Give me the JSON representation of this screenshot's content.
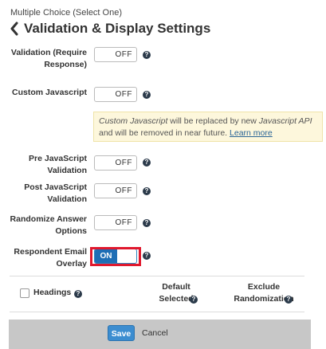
{
  "breadcrumb": "Multiple Choice (Select One)",
  "title": "Validation & Display Settings",
  "icons": {
    "back": "chevron-left-icon",
    "help": "question-circle-icon"
  },
  "settings": [
    {
      "label": "Validation (Require Response)",
      "state": "OFF"
    },
    {
      "label": "Custom Javascript",
      "state": "OFF"
    },
    {
      "label": "Pre JavaScript Validation",
      "state": "OFF"
    },
    {
      "label": "Post JavaScript Validation",
      "state": "OFF"
    },
    {
      "label": "Randomize Answer Options",
      "state": "OFF"
    },
    {
      "label": "Respondent Email Overlay",
      "state": "ON"
    }
  ],
  "notice": {
    "part1": "Custom Javascript",
    "part2": " will be replaced by new ",
    "part3": "Javascript API",
    "part4": " and will be removed in near future. ",
    "link": "Learn more"
  },
  "table_headers": {
    "headings": "Headings",
    "default_selected": "Default Selected",
    "exclude_randomization": "Exclude Randomization"
  },
  "footer": {
    "save": "Save",
    "cancel": "Cancel"
  },
  "colors": {
    "on_toggle": "#1e6eb5",
    "highlight": "#e0182d",
    "notice_bg": "#fdf7dc",
    "save_button": "#3c8dd0"
  }
}
